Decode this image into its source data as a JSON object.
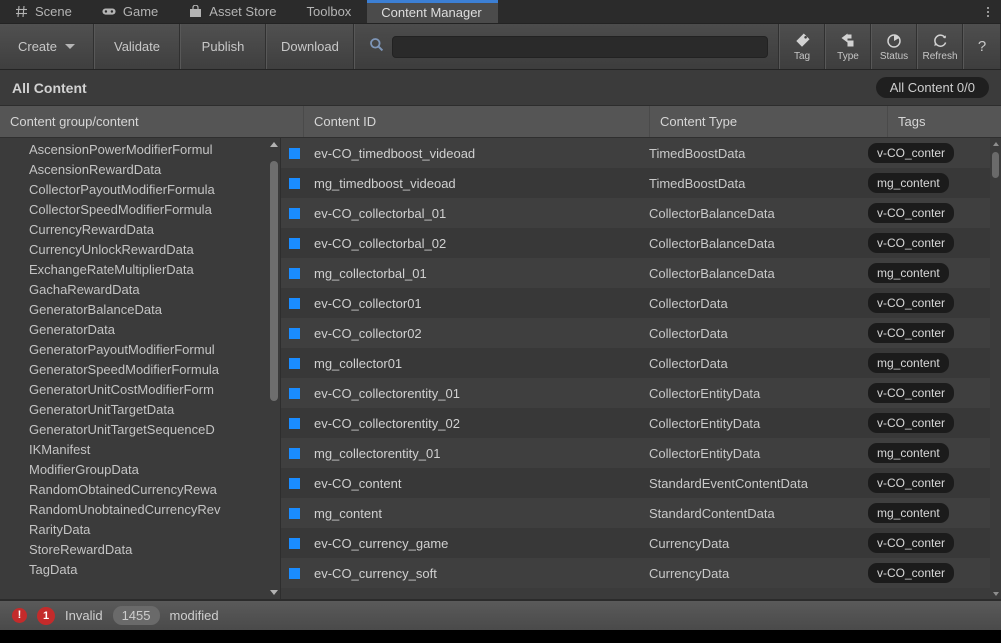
{
  "window": {
    "tabs": [
      {
        "label": "Scene",
        "icon": "grid-icon",
        "active": false
      },
      {
        "label": "Game",
        "icon": "gamepad-icon",
        "active": false
      },
      {
        "label": "Asset Store",
        "icon": "store-icon",
        "active": false
      },
      {
        "label": "Toolbox",
        "icon": "none",
        "active": false
      },
      {
        "label": "Content Manager",
        "icon": "none",
        "active": true
      }
    ],
    "overflow_menu": "kebab-menu-icon",
    "accent_color": "#3c7fd4"
  },
  "toolbar": {
    "create_label": "Create",
    "validate_label": "Validate",
    "publish_label": "Publish",
    "download_label": "Download",
    "search": {
      "value": "",
      "placeholder": "",
      "icon": "search-icon"
    },
    "icon_buttons": [
      {
        "label": "Tag",
        "icon": "tag-icon"
      },
      {
        "label": "Type",
        "icon": "type-icon"
      },
      {
        "label": "Status",
        "icon": "status-pie-icon"
      },
      {
        "label": "Refresh",
        "icon": "refresh-icon"
      }
    ],
    "help_label": "?"
  },
  "section": {
    "title": "All Content",
    "count_badge": "All Content 0/0"
  },
  "columns": [
    {
      "key": "group",
      "label": "Content group/content"
    },
    {
      "key": "id",
      "label": "Content ID"
    },
    {
      "key": "type",
      "label": "Content Type"
    },
    {
      "key": "tags",
      "label": "Tags"
    }
  ],
  "tree": {
    "items": [
      "AscensionPowerModifierFormul",
      "AscensionRewardData",
      "CollectorPayoutModifierFormula",
      "CollectorSpeedModifierFormula",
      "CurrencyRewardData",
      "CurrencyUnlockRewardData",
      "ExchangeRateMultiplierData",
      "GachaRewardData",
      "GeneratorBalanceData",
      "GeneratorData",
      "GeneratorPayoutModifierFormul",
      "GeneratorSpeedModifierFormula",
      "GeneratorUnitCostModifierForm",
      "GeneratorUnitTargetData",
      "GeneratorUnitTargetSequenceD",
      "IKManifest",
      "ModifierGroupData",
      "RandomObtainedCurrencyRewa",
      "RandomUnobtainedCurrencyRev",
      "RarityData",
      "StoreRewardData",
      "TagData"
    ],
    "scrollbar": {
      "up_icon": "triangle-up-icon",
      "down_icon": "triangle-down-icon"
    }
  },
  "table": {
    "rows": [
      {
        "icon": "blue-square-icon",
        "id": "ev-CO_timedboost_videoad",
        "type": "TimedBoostData",
        "tag": "v-CO_conter"
      },
      {
        "icon": "blue-square-icon",
        "id": "mg_timedboost_videoad",
        "type": "TimedBoostData",
        "tag": "mg_content"
      },
      {
        "icon": "blue-square-icon",
        "id": "ev-CO_collectorbal_01",
        "type": "CollectorBalanceData",
        "tag": "v-CO_conter"
      },
      {
        "icon": "blue-square-icon",
        "id": "ev-CO_collectorbal_02",
        "type": "CollectorBalanceData",
        "tag": "v-CO_conter"
      },
      {
        "icon": "blue-square-icon",
        "id": "mg_collectorbal_01",
        "type": "CollectorBalanceData",
        "tag": "mg_content"
      },
      {
        "icon": "blue-square-icon",
        "id": "ev-CO_collector01",
        "type": "CollectorData",
        "tag": "v-CO_conter"
      },
      {
        "icon": "blue-square-icon",
        "id": "ev-CO_collector02",
        "type": "CollectorData",
        "tag": "v-CO_conter"
      },
      {
        "icon": "blue-square-icon",
        "id": "mg_collector01",
        "type": "CollectorData",
        "tag": "mg_content"
      },
      {
        "icon": "blue-square-icon",
        "id": "ev-CO_collectorentity_01",
        "type": "CollectorEntityData",
        "tag": "v-CO_conter"
      },
      {
        "icon": "blue-square-icon",
        "id": "ev-CO_collectorentity_02",
        "type": "CollectorEntityData",
        "tag": "v-CO_conter"
      },
      {
        "icon": "blue-square-icon",
        "id": "mg_collectorentity_01",
        "type": "CollectorEntityData",
        "tag": "mg_content"
      },
      {
        "icon": "blue-square-icon",
        "id": "ev-CO_content",
        "type": "StandardEventContentData",
        "tag": "v-CO_conter"
      },
      {
        "icon": "blue-square-icon",
        "id": "mg_content",
        "type": "StandardContentData",
        "tag": "mg_content"
      },
      {
        "icon": "blue-square-icon",
        "id": "ev-CO_currency_game",
        "type": "CurrencyData",
        "tag": "v-CO_conter"
      },
      {
        "icon": "blue-square-icon",
        "id": "ev-CO_currency_soft",
        "type": "CurrencyData",
        "tag": "v-CO_conter"
      }
    ]
  },
  "statusbar": {
    "error_icon": "!",
    "error_count": "1",
    "invalid_label": "Invalid",
    "modified_count": "1455",
    "modified_label": "modified",
    "error_color": "#c42b2b"
  }
}
